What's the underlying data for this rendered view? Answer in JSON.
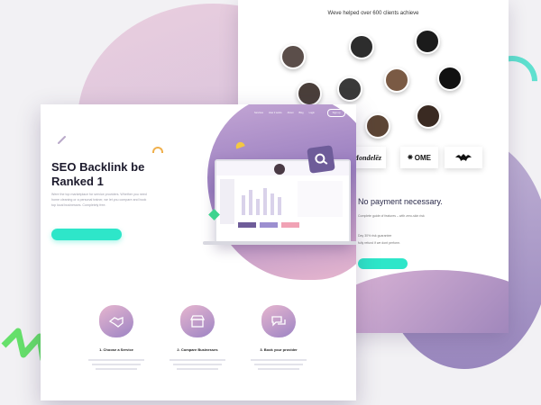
{
  "back_page": {
    "headline": "Weve helped over 600 clients achieve",
    "logos": [
      "Mondelēz",
      "OME"
    ],
    "no_payment_text": "No payment necessary.",
    "lines": [
      "Complete guide of features – with zero-skin risk",
      "fully refund if we dont perform.",
      "Day 30% risk guarantee"
    ]
  },
  "hero": {
    "title": "SEO Backlink be Ranked 1",
    "description": "Were the top marketplace for service providers. Whether you need home cleaning or a personal trainer, we let you compare and book top local businesses. Completely free.",
    "nav": [
      "Services",
      "How it works",
      "About",
      "Blog",
      "Login"
    ],
    "nav_button": "Sign up"
  },
  "steps": [
    {
      "title": "1. Choose a Service",
      "icon": "handshake-icon"
    },
    {
      "title": "2. Compare Businesses",
      "icon": "storefront-icon"
    },
    {
      "title": "3. Book your provider",
      "icon": "chat-icon"
    }
  ],
  "colors": {
    "accent": "#2ee6c9",
    "purple": "#6e5c99",
    "pink": "#e9b8cf"
  }
}
